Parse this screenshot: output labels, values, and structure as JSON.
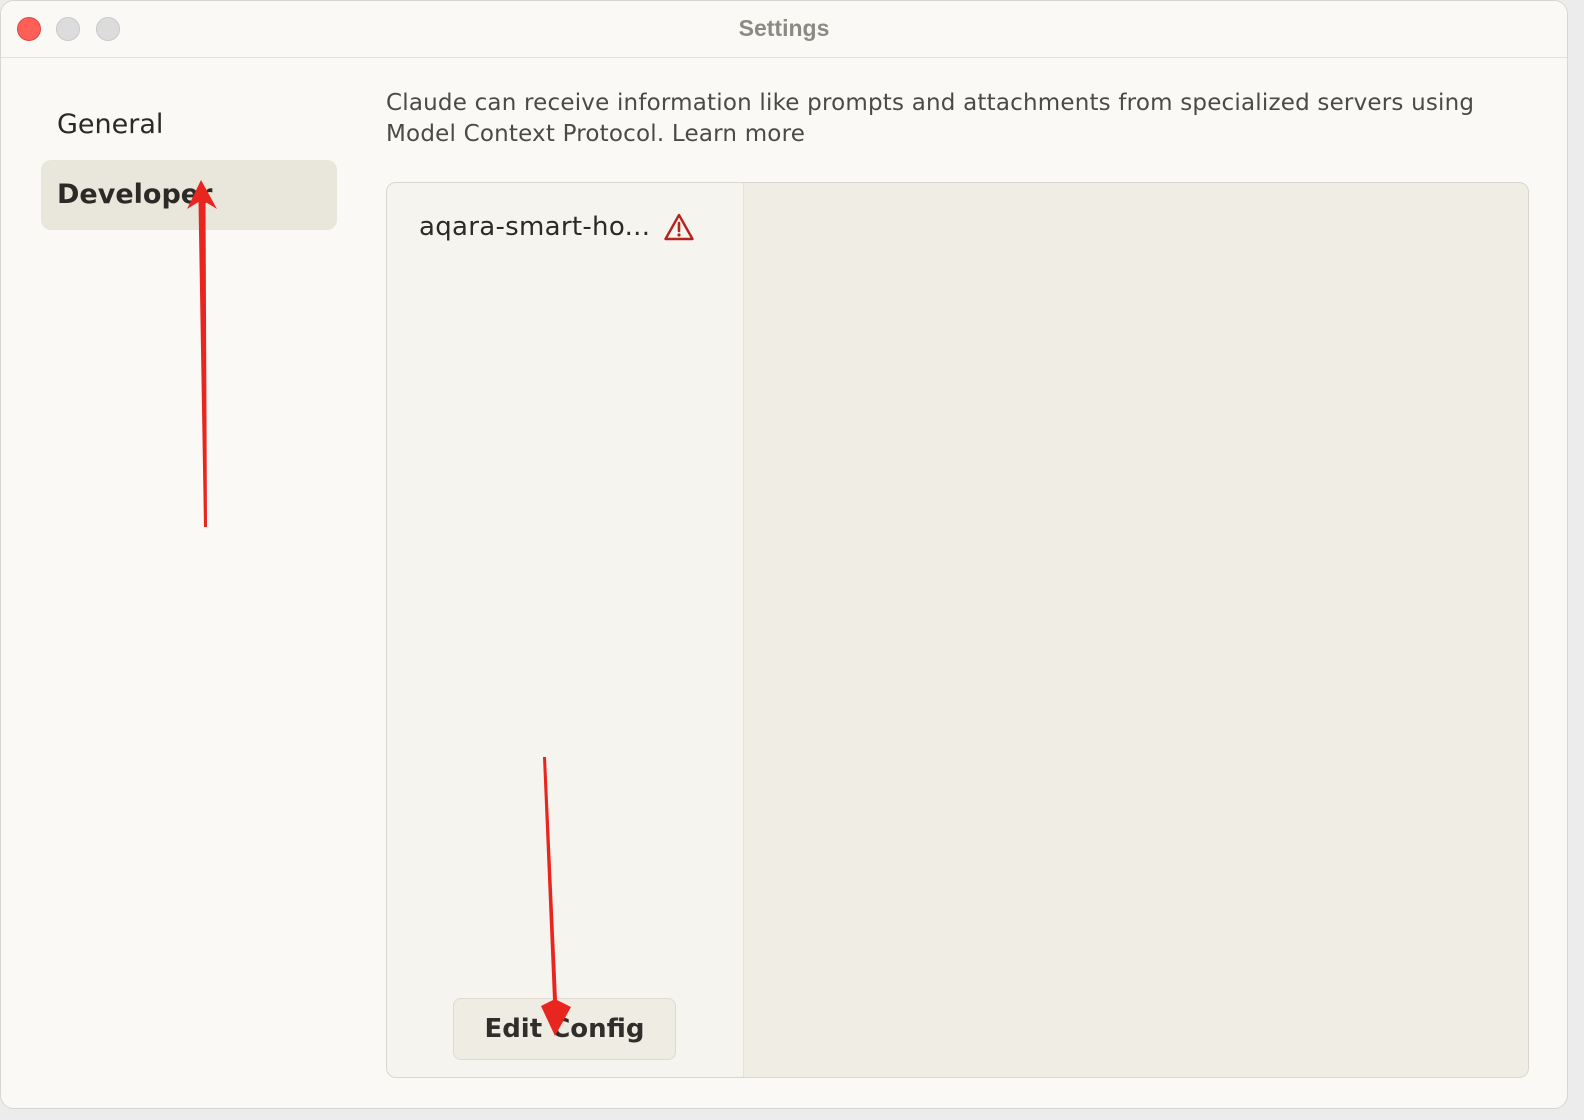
{
  "window": {
    "title": "Settings"
  },
  "sidebar": {
    "items": [
      {
        "label": "General"
      },
      {
        "label": "Developer"
      }
    ]
  },
  "developer": {
    "description": "Claude can receive information like prompts and attachments from specialized servers using Model Context Protocol.",
    "learn_more": "Learn more",
    "servers": [
      {
        "name": "aqara-smart-ho...",
        "status_icon": "warning-triangle-icon"
      }
    ],
    "edit_config_label": "Edit Config"
  },
  "colors": {
    "warning": "#b4231c",
    "annotation_arrow": "#e8261f"
  }
}
